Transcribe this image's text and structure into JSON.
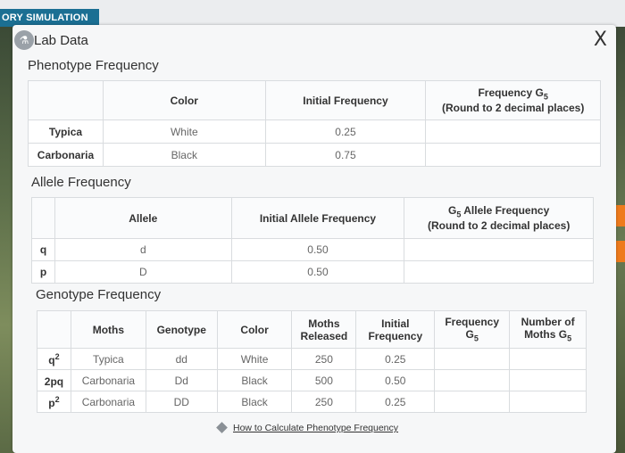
{
  "app_tab": "ORY SIMULATION",
  "dialog": {
    "title": "Lab Data",
    "close_label": "X",
    "icon": "flask-icon"
  },
  "phenotype": {
    "title": "Phenotype Frequency",
    "headers": [
      "",
      "Color",
      "Initial Frequency",
      "Frequency G",
      "5",
      "(Round to 2 decimal places)"
    ],
    "rows": [
      {
        "label": "Typica",
        "color": "White",
        "initial": "0.25",
        "g5": ""
      },
      {
        "label": "Carbonaria",
        "color": "Black",
        "initial": "0.75",
        "g5": ""
      }
    ]
  },
  "allele": {
    "title": "Allele Frequency",
    "headers": [
      "",
      "Allele",
      "Initial Allele Frequency",
      "G",
      "5",
      " Allele Frequency",
      "(Round to 2 decimal places)"
    ],
    "rows": [
      {
        "label": "q",
        "allele": "d",
        "initial": "0.50",
        "g5": ""
      },
      {
        "label": "p",
        "allele": "D",
        "initial": "0.50",
        "g5": ""
      }
    ]
  },
  "genotype": {
    "title": "Genotype Frequency",
    "headers": {
      "moths": "Moths",
      "genotype": "Genotype",
      "color": "Color",
      "released_1": "Moths",
      "released_2": "Released",
      "initial_1": "Initial",
      "initial_2": "Frequency",
      "freq_1": "Frequency",
      "freq_2": "G",
      "freq_sub": "5",
      "num_1": "Number of",
      "num_2": "Moths G",
      "num_sub": "5"
    },
    "rows": [
      {
        "label": "q",
        "label_sup": "2",
        "moths": "Typica",
        "genotype": "dd",
        "color": "White",
        "released": "250",
        "initial": "0.25"
      },
      {
        "label": "2pq",
        "label_sup": "",
        "moths": "Carbonaria",
        "genotype": "Dd",
        "color": "Black",
        "released": "500",
        "initial": "0.50"
      },
      {
        "label": "p",
        "label_sup": "2",
        "moths": "Carbonaria",
        "genotype": "DD",
        "color": "Black",
        "released": "250",
        "initial": "0.25"
      }
    ]
  },
  "footer_link": "How to Calculate Phenotype Frequency"
}
